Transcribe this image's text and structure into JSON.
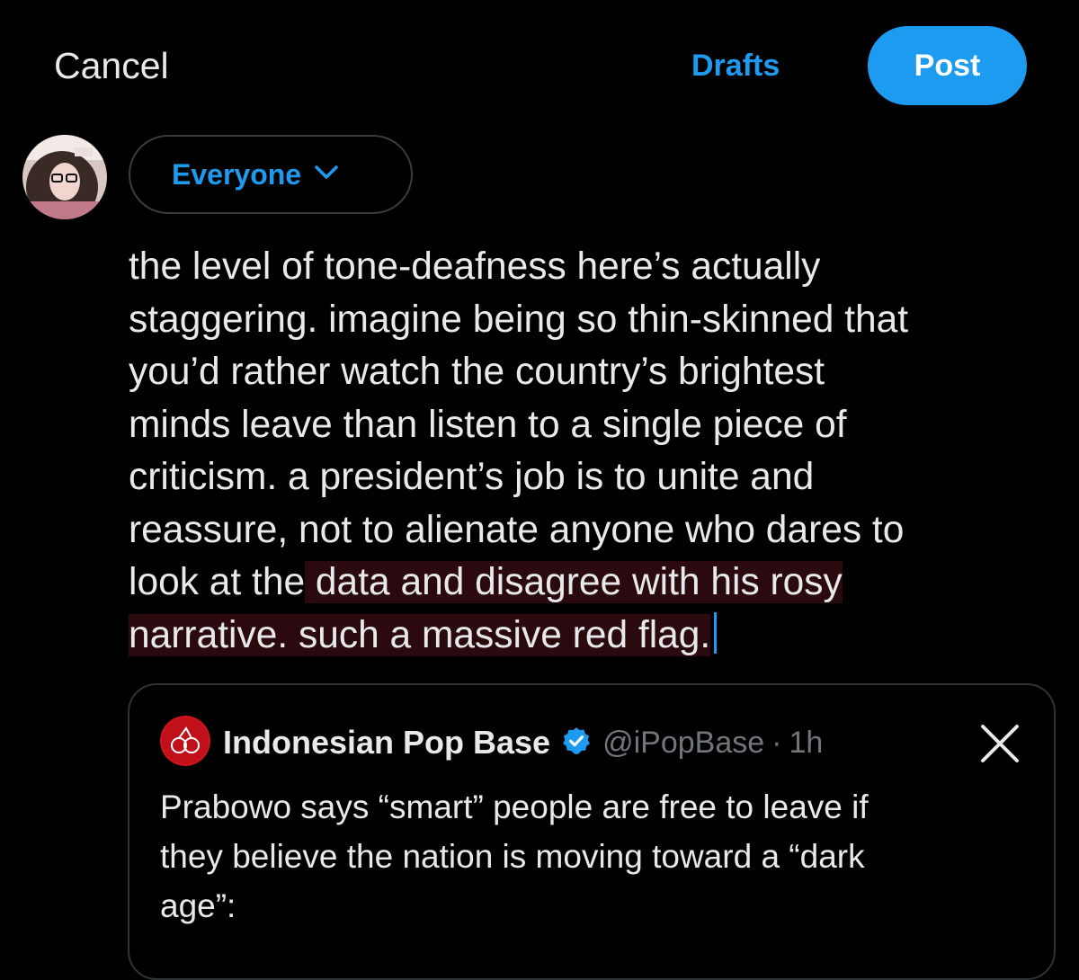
{
  "header": {
    "cancel_label": "Cancel",
    "drafts_label": "Drafts",
    "post_label": "Post"
  },
  "audience": {
    "label": "Everyone",
    "icon": "chevron-down-icon"
  },
  "compose": {
    "lines": [
      {
        "plain": "the level of tone-deafness here’s actually",
        "highlighted": ""
      },
      {
        "plain": "staggering. imagine being so thin-skinned that",
        "highlighted": ""
      },
      {
        "plain": "you’d rather watch the country’s brightest",
        "highlighted": ""
      },
      {
        "plain": "minds leave than listen to a single piece of",
        "highlighted": ""
      },
      {
        "plain": "criticism. a president’s job is to unite and",
        "highlighted": ""
      },
      {
        "plain": "reassure, not to alienate anyone who dares to",
        "highlighted": ""
      },
      {
        "plain": "look at the",
        "highlighted": " data and disagree with his rosy"
      },
      {
        "plain": "",
        "highlighted": "narrative. such a massive red flag."
      }
    ]
  },
  "quote": {
    "name": "Indonesian Pop Base",
    "handle": "@iPopBase",
    "separator": "·",
    "time": "1h",
    "text_lines": [
      "Prabowo says “smart” people are free to leave if",
      "they believe the nation is moving toward a “dark",
      "age”:"
    ],
    "verified_icon": "verified-badge-icon",
    "remove_icon": "x-close-icon"
  },
  "colors": {
    "background": "#000000",
    "accent": "#1d9bf0",
    "text": "#e7e9ea",
    "muted": "#71767b",
    "highlight": "#2a0a0e",
    "border": "#2f3336"
  }
}
